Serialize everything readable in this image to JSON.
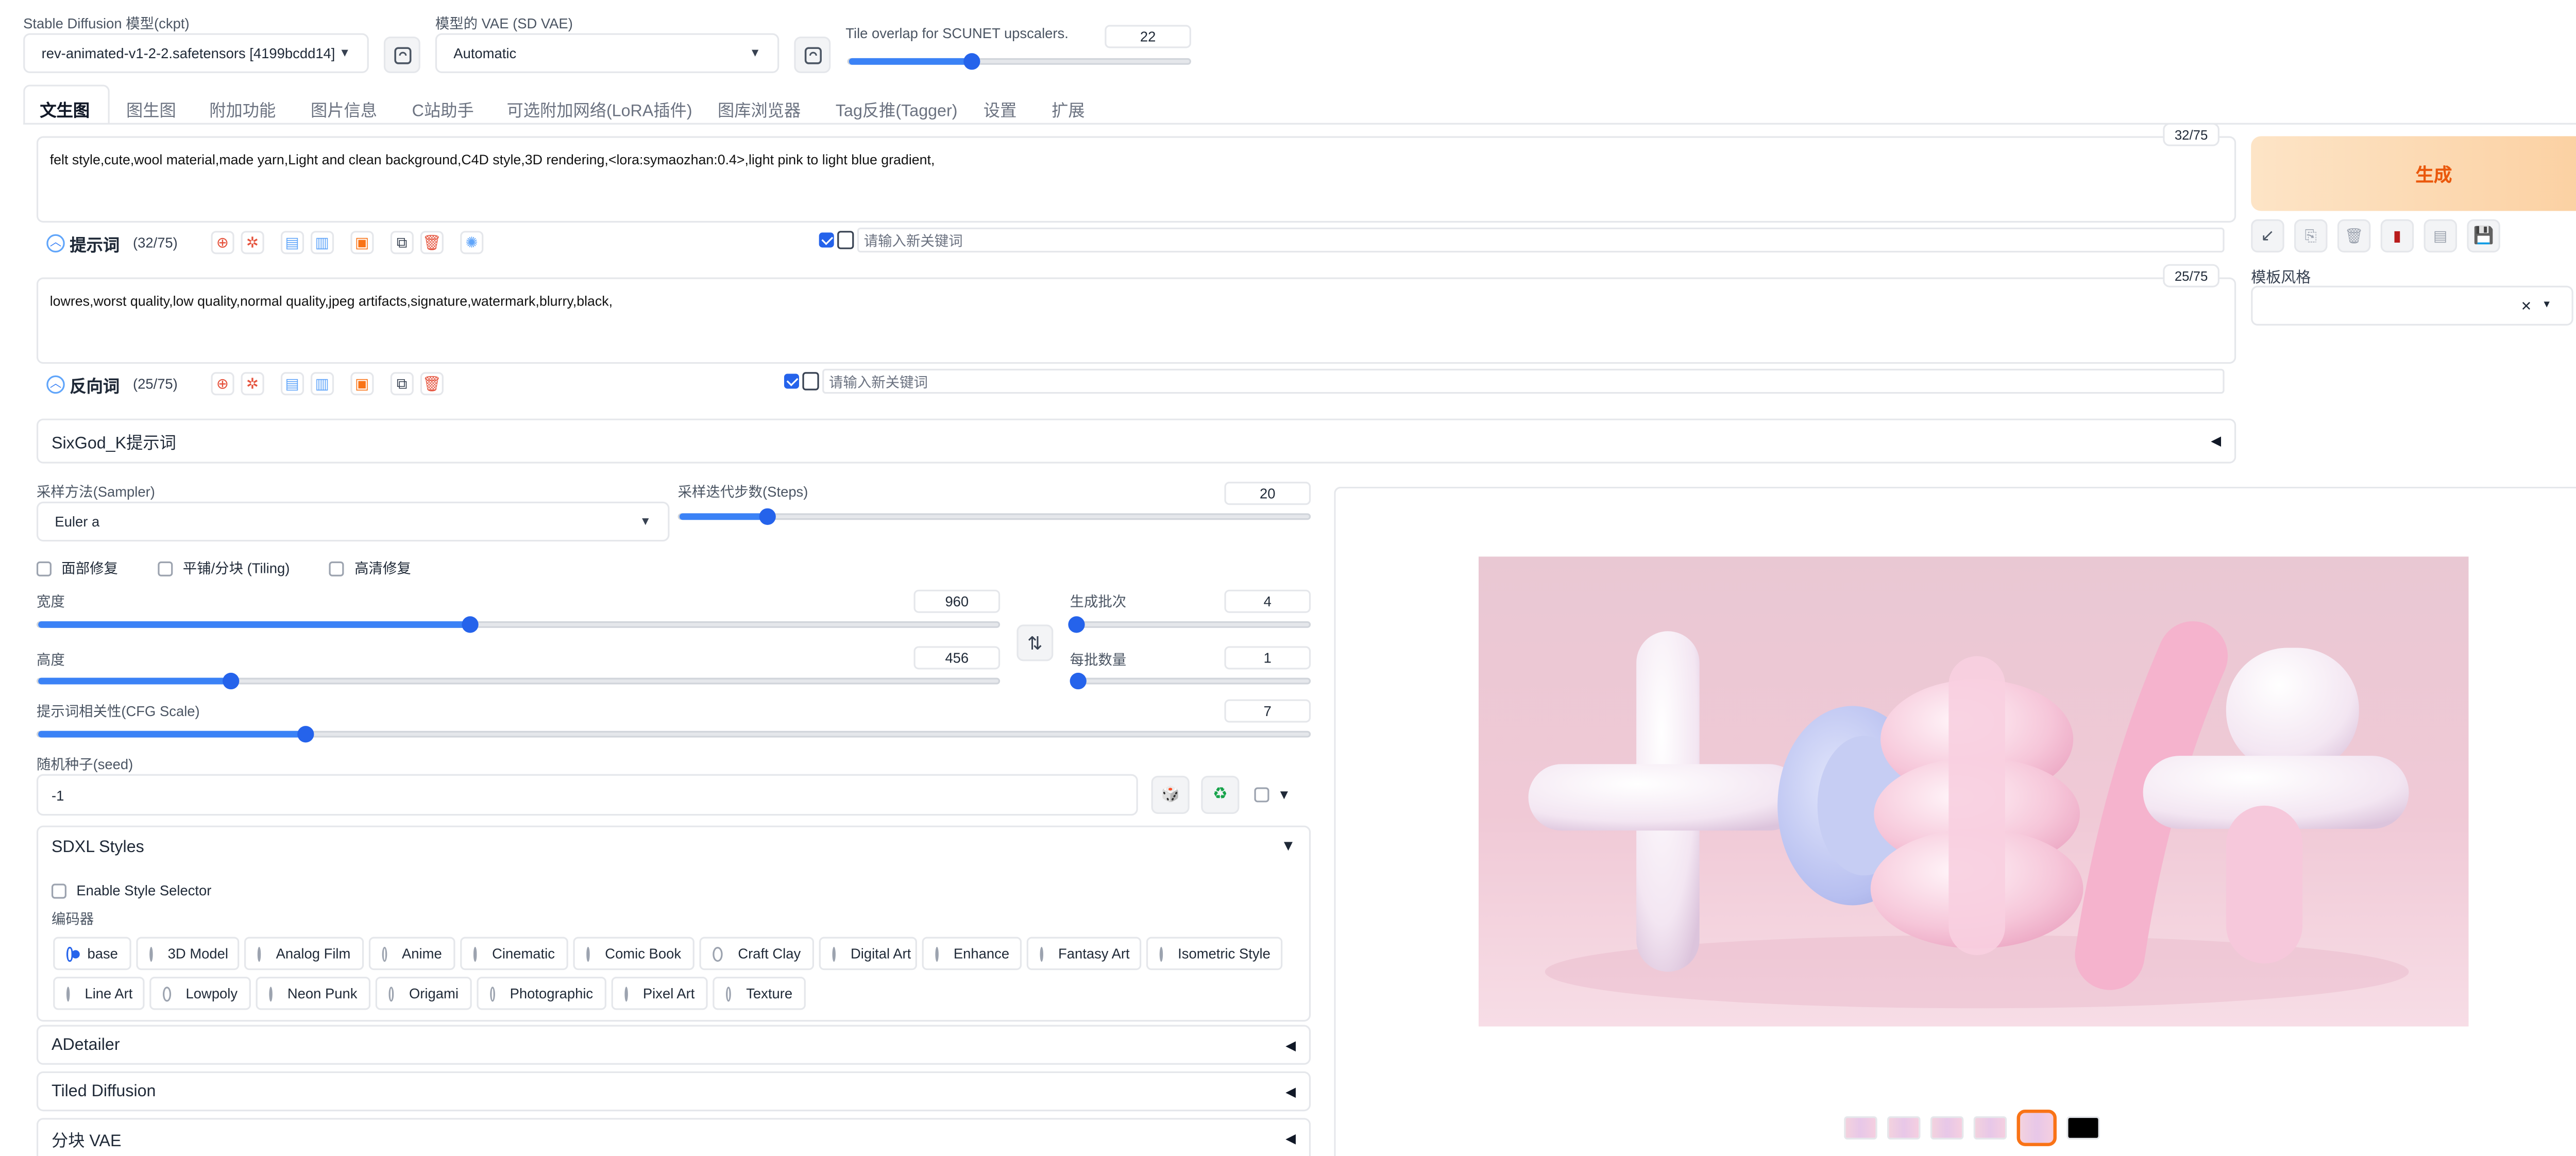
{
  "top": {
    "ckpt_label": "Stable Diffusion 模型(ckpt)",
    "ckpt_value": "rev-animated-v1-2-2.safetensors [4199bcdd14]",
    "vae_label": "模型的 VAE (SD VAE)",
    "vae_value": "Automatic",
    "tile_label": "Tile overlap for SCUNET upscalers.",
    "tile_value": "22",
    "tile_fraction": 0.36
  },
  "tabs": [
    "文生图",
    "图生图",
    "附加功能",
    "图片信息",
    "C站助手",
    "可选附加网络(LoRA插件)",
    "图库浏览器",
    "Tag反推(Tagger)",
    "设置",
    "扩展"
  ],
  "prompt": {
    "text": "felt style,cute,wool material,made yarn,Light and clean background,C4D style,3D rendering,<lora:symaozhan:0.4>,light pink to light blue gradient,",
    "counter": "32/75",
    "toolbar_label": "提示词",
    "toolbar_count": "(32/75)",
    "keyword_placeholder": "请输入新关键词"
  },
  "negative": {
    "text": "lowres,worst quality,low quality,normal quality,jpeg artifacts,signature,watermark,blurry,black,",
    "counter": "25/75",
    "toolbar_label": "反向词",
    "toolbar_count": "(25/75)",
    "keyword_placeholder": "请输入新关键词"
  },
  "sixgod_label": "SixGod_K提示词",
  "generate_label": "生成",
  "template_style_label": "模板风格",
  "sampler": {
    "label": "采样方法(Sampler)",
    "value": "Euler a"
  },
  "steps": {
    "label": "采样迭代步数(Steps)",
    "value": "20",
    "fraction": 0.14
  },
  "checks": {
    "face": "面部修复",
    "tiling": "平铺/分块 (Tiling)",
    "hires": "高清修复"
  },
  "width": {
    "label": "宽度",
    "value": "960",
    "fraction": 0.45
  },
  "height": {
    "label": "高度",
    "value": "456",
    "fraction": 0.2
  },
  "batch_count": {
    "label": "生成批次",
    "value": "4",
    "fraction": 0.02
  },
  "batch_size": {
    "label": "每批数量",
    "value": "1",
    "fraction": 0.0
  },
  "cfg": {
    "label": "提示词相关性(CFG Scale)",
    "value": "7",
    "fraction": 0.21
  },
  "seed": {
    "label": "随机种子(seed)",
    "value": "-1"
  },
  "sdxl": {
    "title": "SDXL Styles",
    "enable_label": "Enable Style Selector",
    "encoder_label": "编码器",
    "row1": [
      "base",
      "3D Model",
      "Analog Film",
      "Anime",
      "Cinematic",
      "Comic Book",
      "Craft Clay",
      "Digital Art",
      "Enhance",
      "Fantasy Art",
      "Isometric Style"
    ],
    "row2": [
      "Line Art",
      "Lowpoly",
      "Neon Punk",
      "Origami",
      "Photographic",
      "Pixel Art",
      "Texture"
    ],
    "selected": "base"
  },
  "accordions": {
    "adetailer": "ADetailer",
    "tiled": "Tiled Diffusion",
    "vae": "分块 VAE"
  },
  "colors": {
    "accent": "#2563eb",
    "generate_bg": "#fbd3a8",
    "generate_text": "#ea580c",
    "thumb_selected": "#f97316"
  }
}
